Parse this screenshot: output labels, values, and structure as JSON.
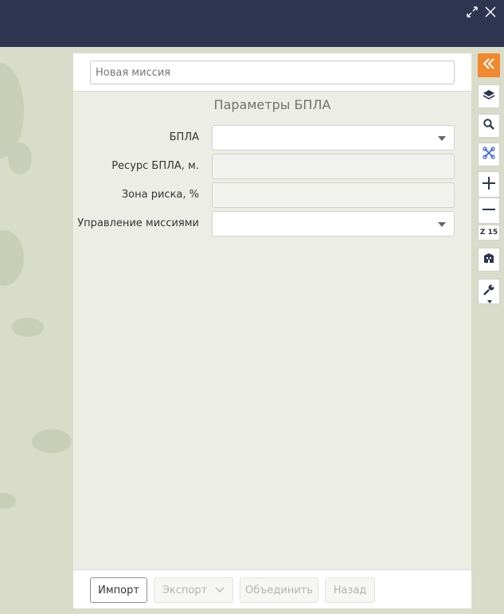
{
  "mission": {
    "name_value": "",
    "name_placeholder": "Новая миссия"
  },
  "section_title": "Параметры БПЛА",
  "fields": [
    {
      "label": "БПЛА",
      "type": "select",
      "value": ""
    },
    {
      "label": "Ресурс БПЛА, м.",
      "type": "readonly",
      "value": ""
    },
    {
      "label": "Зона риска, %",
      "type": "readonly",
      "value": ""
    },
    {
      "label": "Управление миссиями",
      "type": "select",
      "value": ""
    }
  ],
  "footer": {
    "import_label": "Импорт",
    "export_label": "Экспорт",
    "merge_label": "Объединить",
    "back_label": "Назад"
  },
  "toolbar": {
    "zoom_text": "Z 15",
    "icons": [
      "collapse-icon",
      "layers-icon",
      "search-icon",
      "drone-icon",
      "zoom-in-icon",
      "zoom-out-icon",
      "building-icon",
      "wrench-icon"
    ]
  },
  "colors": {
    "header": "#2d3550",
    "accent": "#f0892d",
    "drone_icon": "#3a63d8"
  }
}
